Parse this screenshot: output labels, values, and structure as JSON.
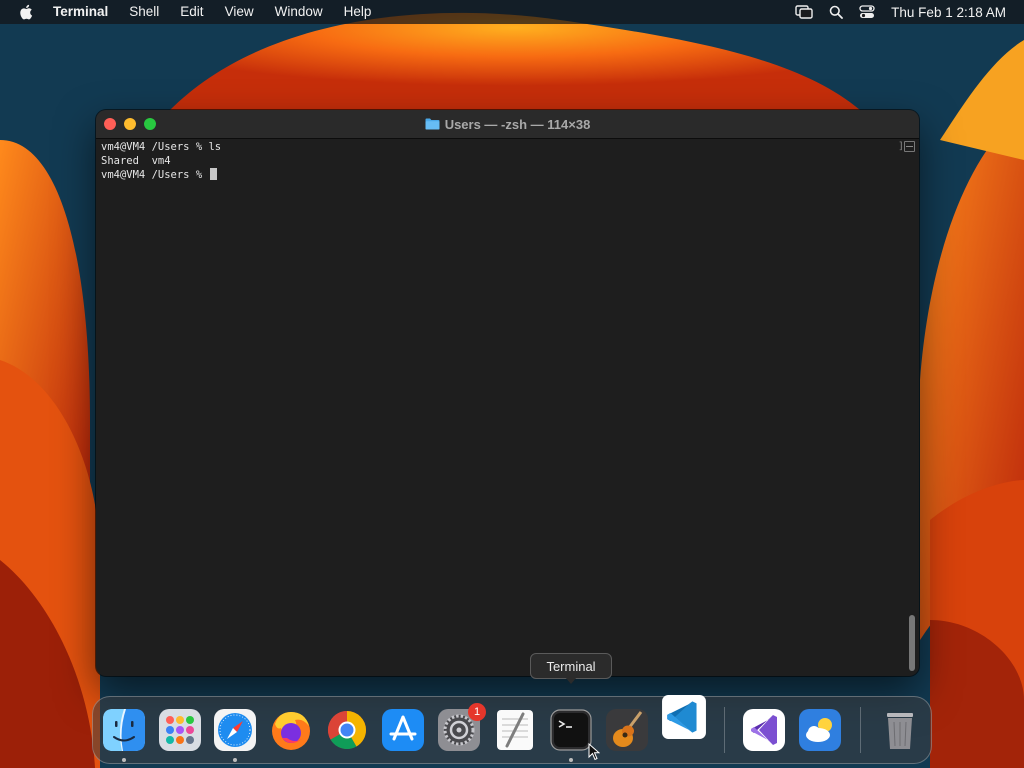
{
  "menubar": {
    "app_name": "Terminal",
    "items": [
      "Shell",
      "Edit",
      "View",
      "Window",
      "Help"
    ],
    "clock": "Thu Feb 1  2:18 AM"
  },
  "window": {
    "title": "Users — -zsh — 114×38",
    "lines": [
      "vm4@VM4 /Users % ls",
      "Shared  vm4",
      "vm4@VM4 /Users % "
    ],
    "scroll_marker": "]"
  },
  "tooltip": "Terminal",
  "dock": {
    "badge": "1",
    "items": [
      "finder-icon",
      "launchpad-icon",
      "safari-icon",
      "firefox-icon",
      "chrome-icon",
      "app-store-icon",
      "system-settings-icon",
      "textedit-icon",
      "terminal-icon",
      "garageband-icon",
      "vscode-icon",
      "visual-studio-icon",
      "weather-icon",
      "trash-icon"
    ]
  },
  "colors": {
    "close": "#ff5f57",
    "minimize": "#febc2e",
    "maximize": "#28c840",
    "terminal_bg": "#1e1e1e",
    "badge": "#e5362b"
  }
}
